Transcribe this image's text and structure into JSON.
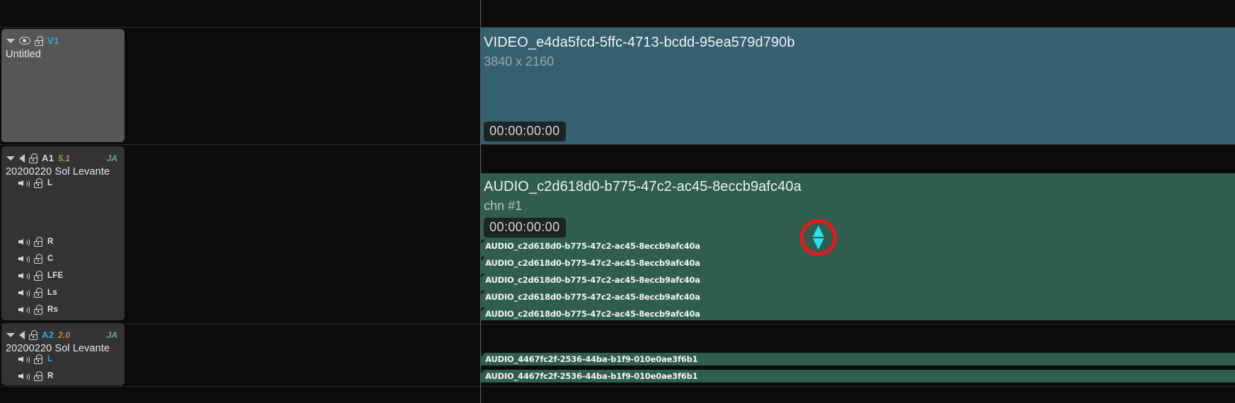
{
  "app": {
    "name": "timeline-editor"
  },
  "tracks": [
    {
      "id": "V1",
      "kind": "video",
      "name": "Untitled",
      "format": "",
      "language": "",
      "expanded": true,
      "icons": [
        "disclosure-triangle",
        "eye",
        "unlocked-padlock"
      ]
    },
    {
      "id": "A1",
      "kind": "audio",
      "name": "20200220 Sol Levante",
      "format": "5.1",
      "language": "JA",
      "expanded": true,
      "icons": [
        "disclosure-triangle",
        "speaker",
        "unlocked-padlock"
      ],
      "channels": [
        "L",
        "R",
        "C",
        "LFE",
        "Ls",
        "Rs"
      ]
    },
    {
      "id": "A2",
      "kind": "audio",
      "name": "20200220 Sol Levante",
      "format": "2.0",
      "language": "JA",
      "expanded": true,
      "icons": [
        "disclosure-triangle",
        "speaker",
        "unlocked-padlock"
      ],
      "channels": [
        "L",
        "R"
      ]
    }
  ],
  "clips": {
    "video": {
      "title": "VIDEO_e4da5fcd-5ffc-4713-bcdd-95ea579d790b",
      "resolution": "3840 x 2160",
      "timecode": "00:00:00:00"
    },
    "audio": {
      "title": "AUDIO_c2d618d0-b775-47c2-ac45-8eccb9afc40a",
      "channel_label": "chn #1",
      "timecode": "00:00:00:00"
    }
  },
  "subclips_a1": [
    {
      "label": "AUDIO_c2d618d0-b775-47c2-ac45-8eccb9afc40a"
    },
    {
      "label": "AUDIO_c2d618d0-b775-47c2-ac45-8eccb9afc40a"
    },
    {
      "label": "AUDIO_c2d618d0-b775-47c2-ac45-8eccb9afc40a"
    },
    {
      "label": "AUDIO_c2d618d0-b775-47c2-ac45-8eccb9afc40a"
    },
    {
      "label": "AUDIO_c2d618d0-b775-47c2-ac45-8eccb9afc40a"
    }
  ],
  "subclips_a2": [
    {
      "label": "AUDIO_4467fc2f-2536-44ba-b1f9-010e0ae3f6b1"
    },
    {
      "label": "AUDIO_4467fc2f-2536-44ba-b1f9-010e0ae3f6b1"
    }
  ],
  "annotation": {
    "shape": "red-circle-highlight",
    "handle_icon": "vertical-resize-handle",
    "color": "#f11414",
    "handle_color": "#24e3ee"
  },
  "colors": {
    "background": "#0b0b0b",
    "video_clip": "#356070",
    "audio_clip": "#2f5d50",
    "video_header": "#565656",
    "audio_header": "#333333",
    "track_id_accent": "#2fa8e0",
    "format_accent": "#c08a3e",
    "language_accent": "#4fba7b"
  }
}
